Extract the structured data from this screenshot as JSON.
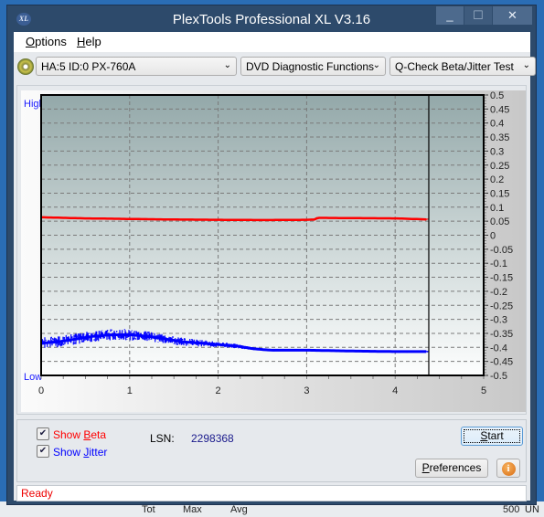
{
  "window": {
    "title": "PlexTools Professional XL V3.16",
    "icon": "xl-app-icon",
    "controls": {
      "minimize": "_",
      "maximize": "☐",
      "close": "✕"
    }
  },
  "menu": {
    "items": [
      {
        "label": "Options",
        "mnemonic": "O"
      },
      {
        "label": "Help",
        "mnemonic": "H"
      }
    ]
  },
  "toolbar": {
    "drive_select": "HA:5 ID:0  PX-760A",
    "function_select": "DVD Diagnostic Functions",
    "test_select": "Q-Check Beta/Jitter Test",
    "dropdown_glyph": "⌄"
  },
  "graph": {
    "high_label": "High",
    "low_label": "Low"
  },
  "chart_data": {
    "type": "line",
    "title": "",
    "xlabel": "",
    "ylabel": "",
    "xlim": [
      0,
      5
    ],
    "ylim": [
      -0.5,
      0.5
    ],
    "x_ticks": [
      "0",
      "1",
      "2",
      "3",
      "4",
      "5"
    ],
    "y_ticks": [
      "0.5",
      "0.45",
      "0.4",
      "0.35",
      "0.3",
      "0.25",
      "0.2",
      "0.15",
      "0.1",
      "0.05",
      "0",
      "-0.05",
      "-0.1",
      "-0.15",
      "-0.2",
      "-0.25",
      "-0.3",
      "-0.35",
      "-0.4",
      "-0.45",
      "-0.5"
    ],
    "grid": true,
    "end_marker_x": 4.38,
    "series": [
      {
        "name": "Beta",
        "color": "#ff0000",
        "x": [
          0,
          0.25,
          0.5,
          1.0,
          1.5,
          2.0,
          2.5,
          3.0,
          3.1,
          3.12,
          3.5,
          4.0,
          4.2,
          4.38
        ],
        "y": [
          0.064,
          0.062,
          0.06,
          0.058,
          0.056,
          0.055,
          0.054,
          0.055,
          0.056,
          0.062,
          0.061,
          0.06,
          0.058,
          0.056
        ],
        "noise": 0.003
      },
      {
        "name": "Jitter",
        "color": "#0000ff",
        "x": [
          0,
          0.2,
          0.4,
          0.6,
          0.8,
          1.0,
          1.2,
          1.4,
          1.6,
          1.8,
          2.0,
          2.2,
          2.4,
          2.6,
          3.0,
          3.5,
          4.0,
          4.38
        ],
        "y": [
          -0.385,
          -0.38,
          -0.37,
          -0.36,
          -0.355,
          -0.355,
          -0.36,
          -0.37,
          -0.38,
          -0.385,
          -0.39,
          -0.395,
          -0.405,
          -0.41,
          -0.41,
          -0.413,
          -0.415,
          -0.415
        ],
        "noise": [
          0.02,
          0.02,
          0.02,
          0.02,
          0.02,
          0.02,
          0.018,
          0.016,
          0.014,
          0.012,
          0.01,
          0.008,
          0.005,
          0.004,
          0.004,
          0.004,
          0.004,
          0.004
        ]
      }
    ]
  },
  "controls": {
    "show_beta": {
      "label_pre": "Show ",
      "mnemonic": "B",
      "label_post": "eta",
      "checked": true,
      "color": "#ff0000"
    },
    "show_jitter": {
      "label_pre": "Show ",
      "mnemonic": "J",
      "label_post": "itter",
      "checked": true,
      "color": "#0000ff"
    },
    "lsn_label": "LSN:",
    "lsn_value": "2298368",
    "start_button": {
      "mnemonic": "S",
      "rest": "tart"
    },
    "preferences_button": {
      "mnemonic": "P",
      "rest": "references"
    },
    "info_button": "i"
  },
  "status": {
    "text": "Ready"
  },
  "background_strip": {
    "texts": [
      "Tot",
      "Max",
      "Avg",
      "500",
      "UN"
    ]
  }
}
